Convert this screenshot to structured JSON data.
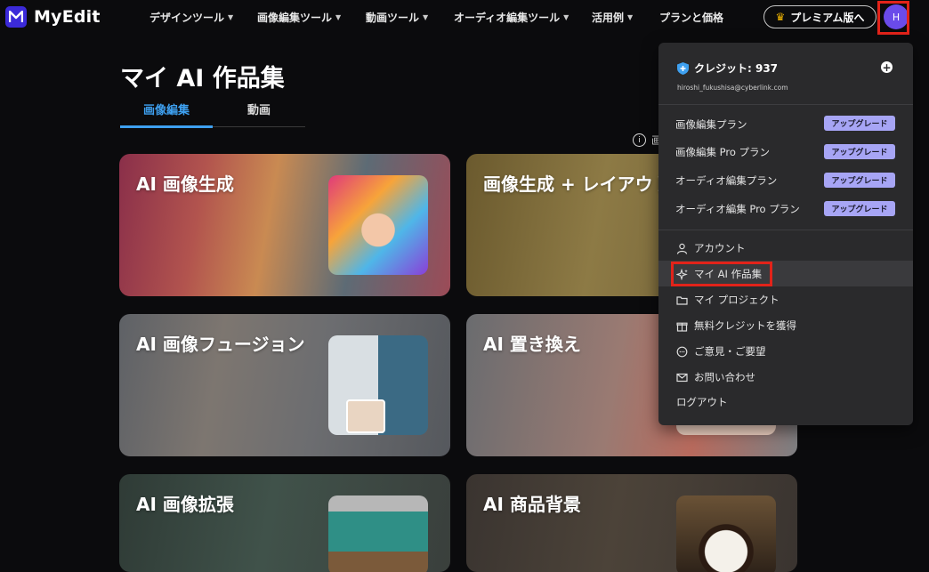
{
  "nav": {
    "logo_text": "MyEdit",
    "menu": [
      {
        "label": "デザインツール",
        "has_chevron": true
      },
      {
        "label": "画像編集ツール",
        "has_chevron": true
      },
      {
        "label": "動画ツール",
        "has_chevron": true
      },
      {
        "label": "オーディオ編集ツール",
        "has_chevron": true
      },
      {
        "label": "活用例",
        "has_chevron": true
      },
      {
        "label": "プランと価格",
        "has_chevron": false
      }
    ],
    "premium_label": "プレミアム版へ",
    "avatar_initial": "H"
  },
  "page": {
    "title": "マイ AI 作品集",
    "tabs": [
      {
        "label": "画像編集",
        "active": true
      },
      {
        "label": "動画",
        "active": false
      }
    ],
    "info_text": "画"
  },
  "cards": [
    {
      "title": "AI 画像生成"
    },
    {
      "title": "画像生成 + レイアウト"
    },
    {
      "title": "AI 画像フュージョン"
    },
    {
      "title": "AI 置き換え"
    },
    {
      "title": "AI 画像拡張"
    },
    {
      "title": "AI 商品背景"
    }
  ],
  "dropdown": {
    "credit_label": "クレジット: 937",
    "email": "hiroshi_fukushisa@cyberlink.com",
    "plans": [
      {
        "label": "画像編集プラン",
        "button": "アップグレード"
      },
      {
        "label": "画像編集 Pro プラン",
        "button": "アップグレード"
      },
      {
        "label": "オーディオ編集プラン",
        "button": "アップグレード"
      },
      {
        "label": "オーディオ編集 Pro プラン",
        "button": "アップグレード"
      }
    ],
    "items": [
      {
        "label": "アカウント",
        "icon": "user-icon"
      },
      {
        "label": "マイ AI 作品集",
        "icon": "sparkle-icon"
      },
      {
        "label": "マイ プロジェクト",
        "icon": "folder-icon"
      },
      {
        "label": "無料クレジットを獲得",
        "icon": "gift-icon"
      },
      {
        "label": "ご意見・ご要望",
        "icon": "feedback-icon"
      },
      {
        "label": "お問い合わせ",
        "icon": "mail-icon"
      }
    ],
    "logout_label": "ログアウト"
  },
  "colors": {
    "accent": "#3ea0f0",
    "avatar": "#6a4bea",
    "upgrade": "#a7a5f5",
    "highlight": "#e2231a",
    "crown": "#f2b600"
  }
}
